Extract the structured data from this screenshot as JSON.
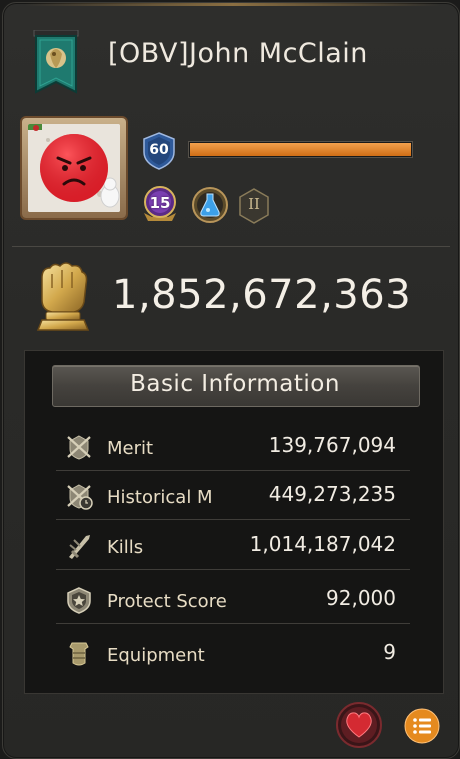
{
  "player": {
    "name": "[OBV]John McClain",
    "level": "60",
    "xp_progress": 1.0,
    "vip_level": "15",
    "rank_numeral": "II"
  },
  "power": {
    "value": "1,852,672,363"
  },
  "basic_info": {
    "title": "Basic Information",
    "rows": [
      {
        "icon": "merit-icon",
        "label": "Merit",
        "value": "139,767,094"
      },
      {
        "icon": "historical-merit-icon",
        "label": "Historical M",
        "value": "449,273,235"
      },
      {
        "icon": "kills-icon",
        "label": "Kills",
        "value": "1,014,187,042"
      },
      {
        "icon": "protect-score-icon",
        "label": "Protect Score",
        "value": "92,000"
      },
      {
        "icon": "equipment-icon",
        "label": "Equipment",
        "value": "9"
      }
    ]
  },
  "buttons": {
    "like": "heart-icon",
    "menu": "list-icon"
  },
  "colors": {
    "xp_bar": "#e08a2e",
    "label": "#e7dcc4",
    "heart": "#c9262c",
    "menu": "#e58a1f"
  }
}
